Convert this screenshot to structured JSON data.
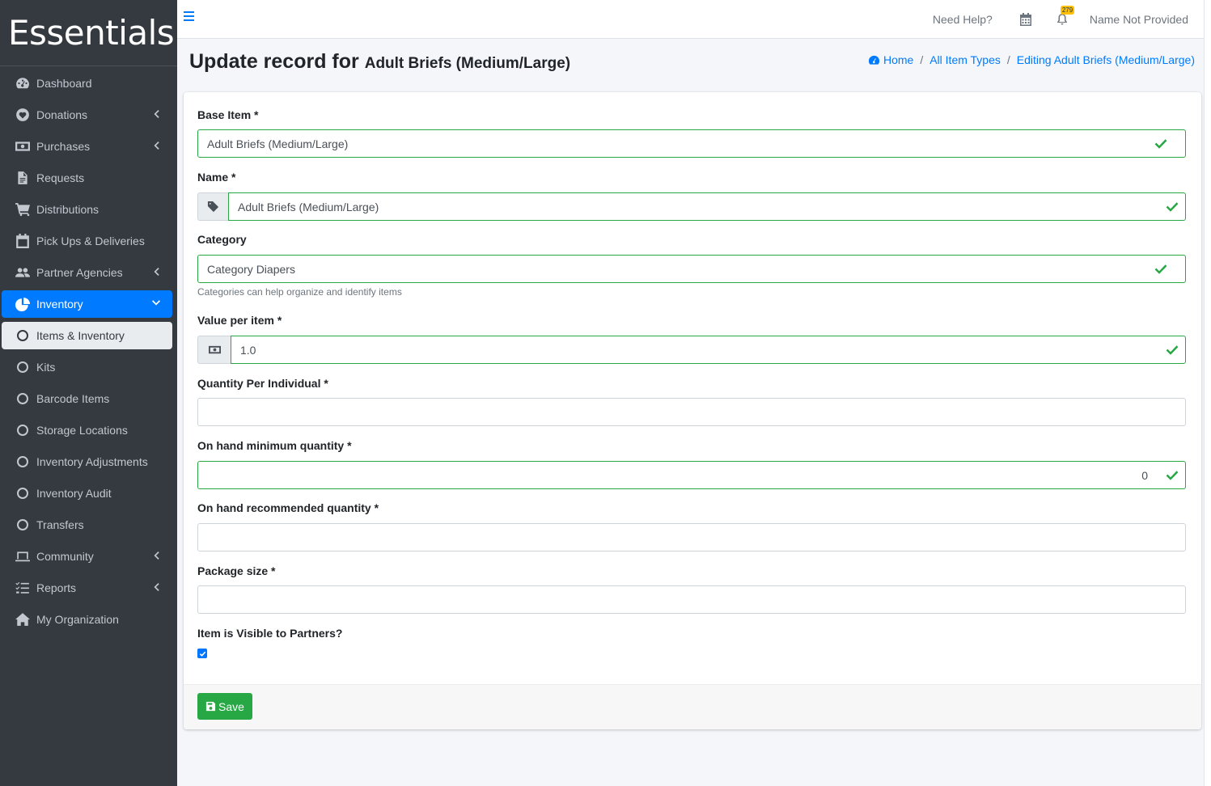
{
  "brand": "Essentials",
  "sidebar": {
    "items": [
      {
        "label": "Dashboard"
      },
      {
        "label": "Donations"
      },
      {
        "label": "Purchases"
      },
      {
        "label": "Requests"
      },
      {
        "label": "Distributions"
      },
      {
        "label": "Pick Ups & Deliveries"
      },
      {
        "label": "Partner Agencies"
      },
      {
        "label": "Inventory"
      },
      {
        "label": "Items & Inventory"
      },
      {
        "label": "Kits"
      },
      {
        "label": "Barcode Items"
      },
      {
        "label": "Storage Locations"
      },
      {
        "label": "Inventory Adjustments"
      },
      {
        "label": "Inventory Audit"
      },
      {
        "label": "Transfers"
      },
      {
        "label": "Community"
      },
      {
        "label": "Reports"
      },
      {
        "label": "My Organization"
      }
    ]
  },
  "topbar": {
    "help": "Need Help?",
    "notification_count": "279",
    "user": "Name Not Provided"
  },
  "header": {
    "title": "Update record for",
    "subtitle": "Adult Briefs (Medium/Large)",
    "breadcrumb": [
      "Home",
      "All Item Types",
      "Editing Adult Briefs (Medium/Large)"
    ]
  },
  "form": {
    "base_item": {
      "label": "Base Item *",
      "value": "Adult Briefs (Medium/Large)"
    },
    "name": {
      "label": "Name *",
      "value": "Adult Briefs (Medium/Large)"
    },
    "category": {
      "label": "Category",
      "value": "Category Diapers",
      "hint": "Categories can help organize and identify items"
    },
    "value_per_item": {
      "label": "Value per item *",
      "value": "1.0"
    },
    "quantity_per_individual": {
      "label": "Quantity Per Individual *",
      "value": ""
    },
    "on_hand_minimum": {
      "label": "On hand minimum quantity *",
      "value": "0"
    },
    "on_hand_recommended": {
      "label": "On hand recommended quantity *",
      "value": ""
    },
    "package_size": {
      "label": "Package size *",
      "value": ""
    },
    "visible_to_partners": {
      "label": "Item is Visible to Partners?",
      "checked": true
    },
    "save_label": "Save"
  },
  "colors": {
    "sidebar_bg": "#343a40",
    "active": "#007bff",
    "valid": "#28a745",
    "badge": "#ffc107"
  }
}
